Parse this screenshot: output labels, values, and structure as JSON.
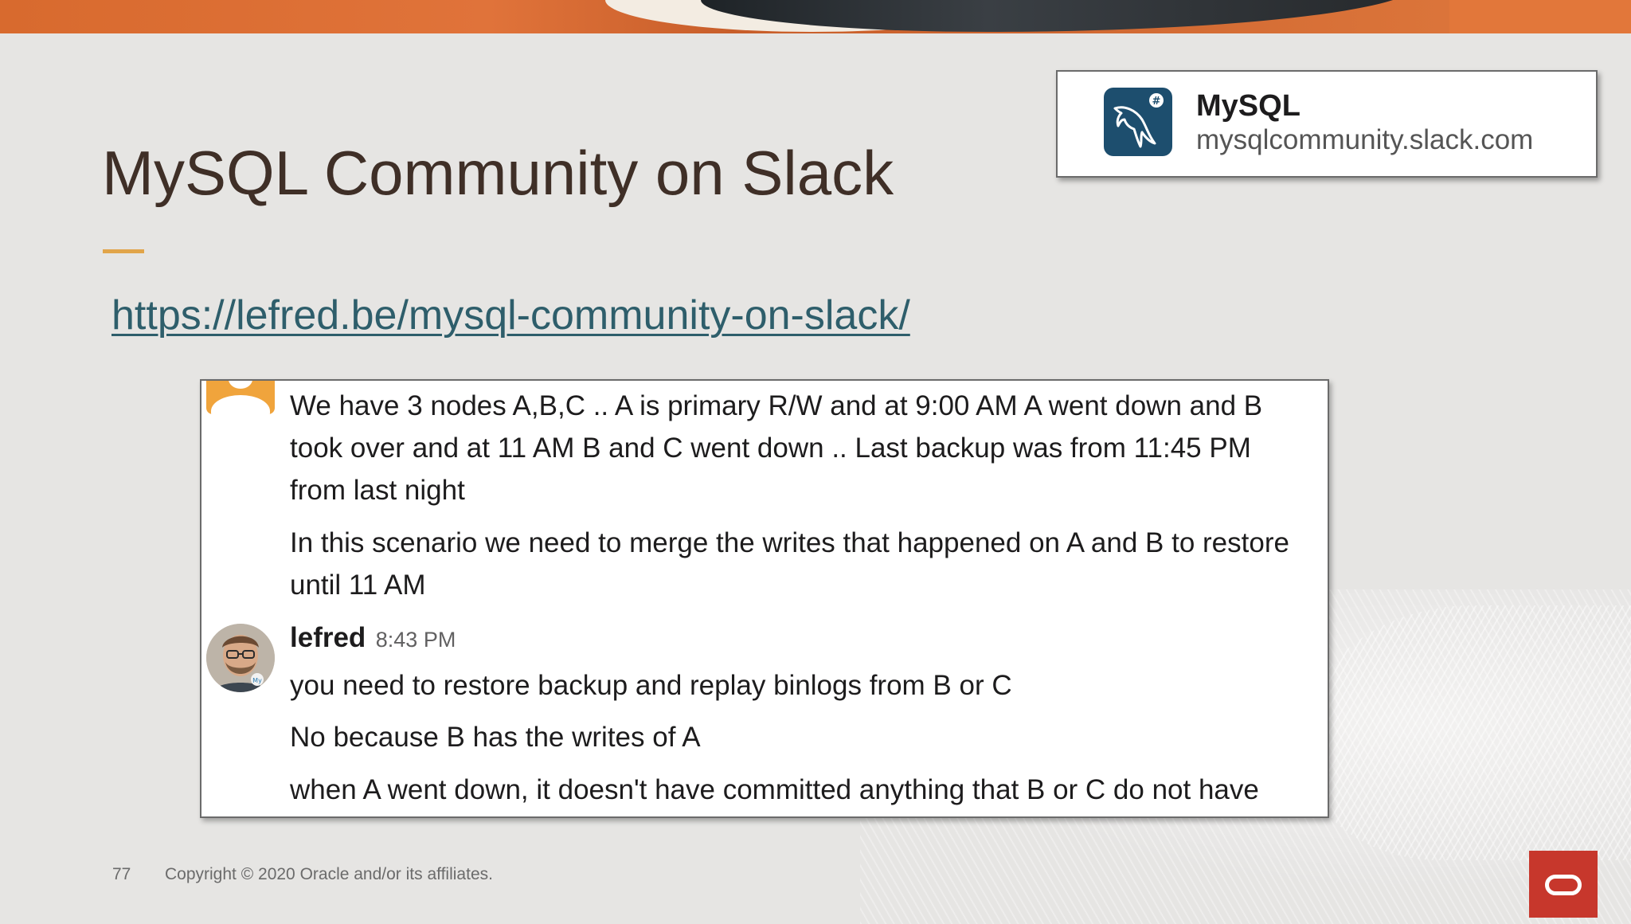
{
  "slide": {
    "title": "MySQL Community on Slack",
    "link": "https://lefred.be/mysql-community-on-slack/",
    "page_number": "77",
    "copyright": "Copyright © 2020 Oracle and/or its affiliates."
  },
  "workspace": {
    "name": "MySQL",
    "url": "mysqlcommunity.slack.com",
    "icon": "mysql-dolphin-icon"
  },
  "chat": {
    "messages_first": [
      "We have 3 nodes A,B,C .. A is primary R/W and at 9:00 AM A went down and B took over and at 11 AM B and C went down .. Last backup was from 11:45 PM from last night",
      "In this scenario we need to merge the writes that happened on A and B to restore until 11 AM"
    ],
    "reply": {
      "sender": "lefred",
      "time": "8:43 PM",
      "lines": [
        "you need to restore backup and replay binlogs from B or C",
        "No because B has the writes of A",
        "when A went down, it doesn't have committed anything that B or C do not have"
      ]
    }
  },
  "colors": {
    "title": "#3f2f27",
    "accent_rule": "#e1a54a",
    "link": "#2e5e6b",
    "oracle_red": "#c7372c",
    "slack_workspace_icon_bg": "#1d4e6e"
  }
}
